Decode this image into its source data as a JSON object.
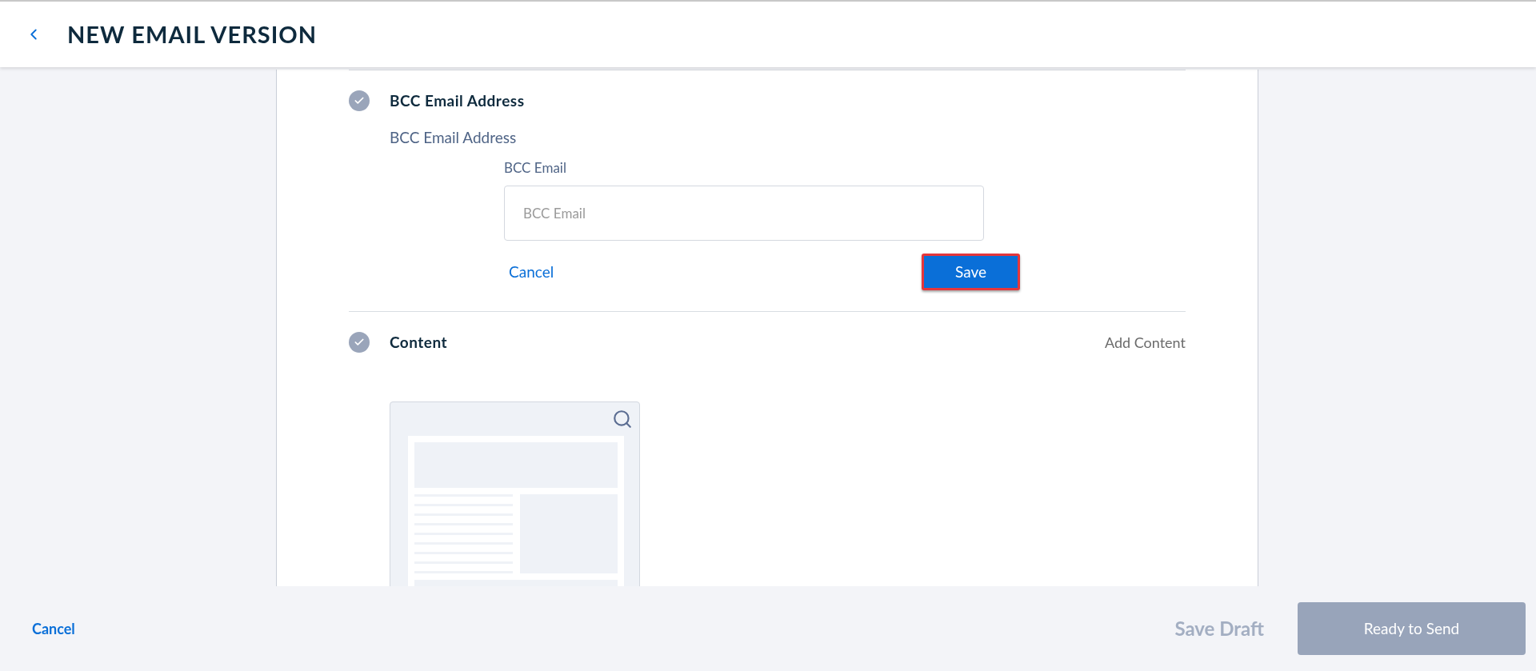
{
  "header": {
    "title": "NEW EMAIL VERSION"
  },
  "sections": [
    {
      "kind": "form",
      "title": "BCC Email Address",
      "completed": true,
      "subtitle": "BCC Email Address",
      "field": {
        "label": "BCC Email",
        "placeholder": "BCC Email"
      },
      "cancel": "Cancel",
      "save": {
        "label": "Save",
        "highlighted": true
      }
    },
    {
      "kind": "content",
      "title": "Content",
      "completed": true,
      "action": "Add Content"
    }
  ],
  "footer": {
    "cancel": "Cancel",
    "save_draft": {
      "label": "Save Draft",
      "disabled": true
    },
    "ready": {
      "label": "Ready to Send",
      "disabled": true
    }
  }
}
